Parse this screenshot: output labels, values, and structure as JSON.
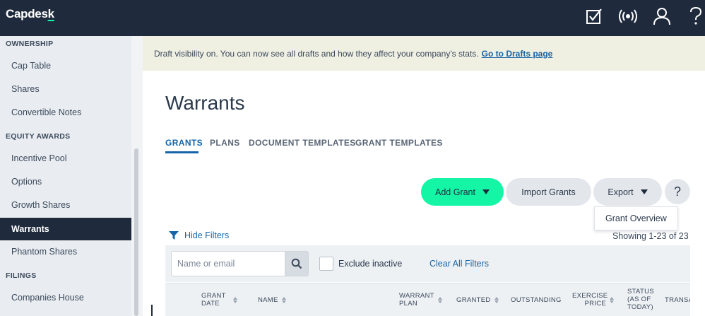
{
  "app": {
    "logo": "Capdesk"
  },
  "topbar": {
    "icons": [
      "tasks-checkbox-icon",
      "broadcast-icon",
      "user-icon",
      "help-icon"
    ]
  },
  "sidebar": {
    "sections": [
      {
        "label": "OWNERSHIP",
        "items": [
          "Cap Table",
          "Shares",
          "Convertible Notes"
        ]
      },
      {
        "label": "EQUITY AWARDS",
        "items": [
          "Incentive Pool",
          "Options",
          "Growth Shares",
          "Warrants",
          "Phantom Shares"
        ]
      },
      {
        "label": "FILINGS",
        "items": [
          "Companies House"
        ]
      }
    ],
    "active_item": "Warrants"
  },
  "banner": {
    "text": "Draft visibility on. You can now see all drafts and how they affect your company's stats.",
    "link": "Go to Drafts page"
  },
  "page": {
    "title": "Warrants",
    "tabs": [
      "GRANTS",
      "PLANS",
      "DOCUMENT TEMPLATES",
      "GRANT TEMPLATES"
    ],
    "active_tab": "GRANTS"
  },
  "actions": {
    "add_grant": "Add Grant",
    "import_grants": "Import Grants",
    "export": "Export",
    "help": "?",
    "export_menu": [
      "Grant Overview"
    ]
  },
  "filters": {
    "toggle_label": "Hide Filters",
    "showing": "Showing 1-23 of 23",
    "search_placeholder": "Name or email",
    "exclude_inactive": "Exclude inactive",
    "exclude_inactive_checked": false,
    "clear_all": "Clear All Filters"
  },
  "table": {
    "columns": [
      "GRANT DATE",
      "NAME",
      "WARRANT PLAN",
      "GRANTED",
      "OUTSTANDING",
      "EXERCISE PRICE",
      "STATUS (AS OF TODAY)",
      "TRANSACTIONS"
    ]
  },
  "colors": {
    "nav_bg": "#1f2b3d",
    "accent_green": "#15f5a6",
    "link_blue": "#1565a8",
    "banner_bg": "#efefe2"
  }
}
